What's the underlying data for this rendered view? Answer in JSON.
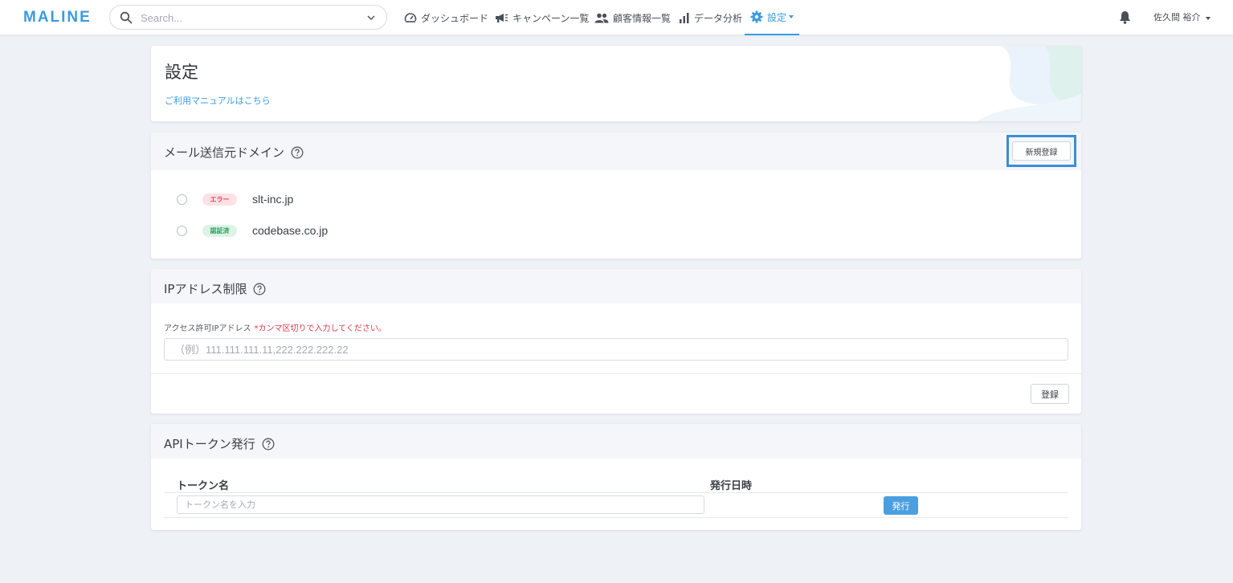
{
  "header": {
    "logo": "MALINE",
    "search_placeholder": "Search...",
    "nav": [
      {
        "label": "ダッシュボード",
        "icon": "speedometer-icon"
      },
      {
        "label": "キャンペーン一覧",
        "icon": "megaphone-icon"
      },
      {
        "label": "顧客情報一覧",
        "icon": "users-icon"
      },
      {
        "label": "データ分析",
        "icon": "bar-chart-icon"
      },
      {
        "label": "設定",
        "icon": "gear-icon",
        "active": true
      }
    ],
    "user_name": "佐久間 裕介"
  },
  "settings": {
    "title": "設定",
    "manual_link": "ご利用マニュアルはこちら"
  },
  "mail_domain": {
    "title": "メール送信元ドメイン",
    "new_button": "新規登録",
    "domains": [
      {
        "status": "エラー",
        "status_type": "error",
        "name": "slt-inc.jp"
      },
      {
        "status": "認証済",
        "status_type": "verified",
        "name": "codebase.co.jp"
      }
    ]
  },
  "ip_restriction": {
    "title": "IPアドレス制限",
    "label": "アクセス許可IPアドレス",
    "required_note": "*カンマ区切りで入力してください。",
    "placeholder": "（例）111.111.111.11,222.222.222.22",
    "register_button": "登録"
  },
  "api_token": {
    "title": "APIトークン発行",
    "col_name": "トークン名",
    "col_date": "発行日時",
    "input_placeholder": "トークン名を入力",
    "issue_button": "発行"
  },
  "colors": {
    "accent": "#3a9be0",
    "error_badge_bg": "#fde1e5",
    "error_badge_text": "#d9435b",
    "verified_badge_bg": "#dcf3e6",
    "verified_badge_text": "#2f9a5a",
    "page_bg": "#eef1f6"
  }
}
